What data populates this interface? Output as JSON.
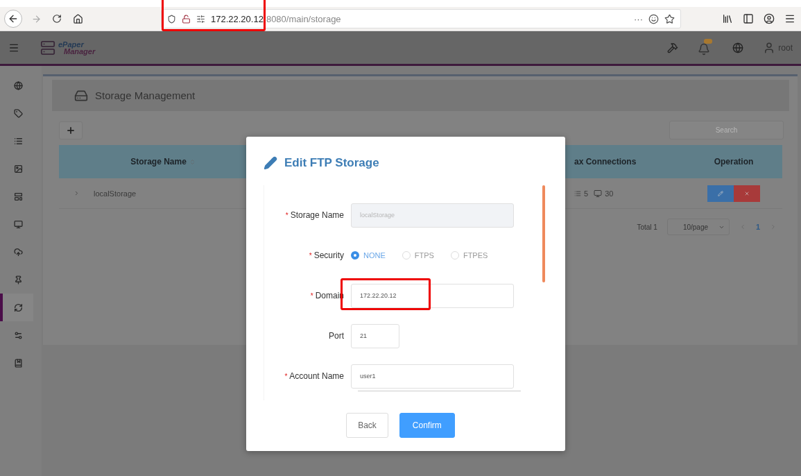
{
  "browser": {
    "url_host": "172.22.20.12",
    "url_path": "8080/main/storage",
    "page_actions": "···"
  },
  "header": {
    "logo_top": "ePaper",
    "logo_bottom": "Manager",
    "user": "root"
  },
  "sidebar": {
    "items": [
      {
        "selected": false
      },
      {
        "selected": false
      },
      {
        "selected": false
      },
      {
        "selected": false
      },
      {
        "selected": false
      },
      {
        "selected": false
      },
      {
        "selected": false
      },
      {
        "selected": false
      },
      {
        "selected": true
      },
      {
        "selected": false
      },
      {
        "selected": false
      }
    ]
  },
  "page": {
    "title": "Storage Management",
    "search": {
      "placeholder": "Search"
    },
    "table": {
      "columns": [
        {
          "label": "Storage Name",
          "sortable": true
        },
        {
          "label": "ax Connections",
          "sortable": false
        },
        {
          "label": "Operation",
          "sortable": false
        }
      ],
      "rows": [
        {
          "name": "localStorage",
          "devices": "5",
          "displays": "30"
        }
      ]
    },
    "pagination": {
      "total": "Total 1",
      "page_size": "10/page",
      "pages": [
        {
          "label": "1",
          "selected": true
        }
      ]
    }
  },
  "dialog": {
    "title": "Edit FTP Storage",
    "fields": [
      {
        "kind": "text",
        "label": "Storage Name",
        "required_mark": "*",
        "value": "localStorage",
        "disabled": true
      },
      {
        "kind": "radio",
        "label": "Security",
        "required_mark": "*",
        "options": [
          {
            "label": "NONE",
            "selected": true
          },
          {
            "label": "FTPS",
            "selected": false
          },
          {
            "label": "FTPES",
            "selected": false
          }
        ]
      },
      {
        "kind": "text",
        "label": "Domain",
        "required_mark": "*",
        "value": "172.22.20.12",
        "disabled": false,
        "highlighted": true
      },
      {
        "kind": "short",
        "label": "Port",
        "value": "21",
        "disabled": false
      },
      {
        "kind": "text",
        "label": "Account Name",
        "required_mark": "*",
        "value": "user1",
        "disabled": false
      },
      {
        "kind": "cut"
      }
    ],
    "buttons": [
      {
        "label": "Back",
        "primary": false
      },
      {
        "label": "Confirm",
        "primary": true
      }
    ]
  },
  "annotations": {
    "url_highlighted": true
  }
}
